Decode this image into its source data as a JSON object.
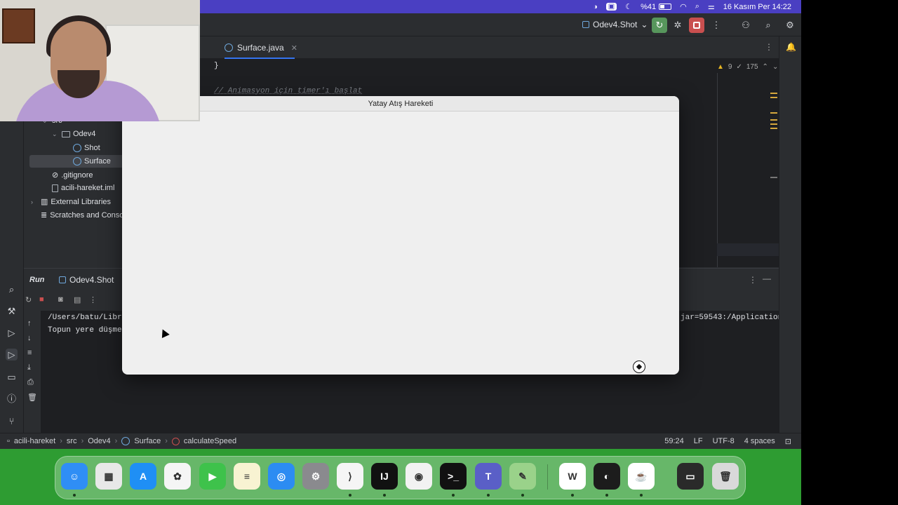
{
  "menubar": {
    "battery": "%41",
    "datetime": "16 Kasım Per  14:22"
  },
  "toolbar": {
    "run_config": "Odev4.Shot"
  },
  "editor": {
    "tab_label": "Surface.java",
    "code_brace": "}",
    "code_comment": "// Animasyon için timer'ı başlat",
    "warning_count": "9",
    "check_count": "175"
  },
  "project_tree": {
    "src": "src",
    "package": "Odev4",
    "file_shot": "Shot",
    "file_surface": "Surface",
    "gitignore": ".gitignore",
    "iml": "acili-hareket.iml",
    "external_libraries": "External Libraries",
    "scratches": "Scratches and Consoles"
  },
  "run_panel": {
    "title": "Run",
    "tab_label": "Odev4.Shot",
    "console_line1": "/Users/batu/Library",
    "console_line1_tail": "jar=59543:/Applications",
    "console_line2": "Topun yere düşme s"
  },
  "swing_window": {
    "title": "Yatay Atış Hareketi"
  },
  "statusbar": {
    "crumbs": [
      "acili-hareket",
      "src",
      "Odev4",
      "Surface",
      "calculateSpeed"
    ],
    "position": "59:24",
    "line_sep": "LF",
    "encoding": "UTF-8",
    "indent": "4 spaces"
  },
  "dock": {
    "apps": [
      {
        "name": "finder",
        "color": "#2f8ef5",
        "glyph": "☺"
      },
      {
        "name": "launchpad",
        "color": "#e8e8e8",
        "glyph": "▦"
      },
      {
        "name": "app-store",
        "color": "#1f8ff5",
        "glyph": "A"
      },
      {
        "name": "photos",
        "color": "#f5f5f5",
        "glyph": "✿"
      },
      {
        "name": "facetime",
        "color": "#3ec24b",
        "glyph": "▶"
      },
      {
        "name": "notes",
        "color": "#f8f3d2",
        "glyph": "≡"
      },
      {
        "name": "safari",
        "color": "#2c8cf2",
        "glyph": "◎"
      },
      {
        "name": "system-settings",
        "color": "#8a8a8e",
        "glyph": "⚙"
      },
      {
        "name": "vscode",
        "color": "#f5f5f5",
        "glyph": "⟩"
      },
      {
        "name": "intellij",
        "color": "#111111",
        "glyph": "IJ"
      },
      {
        "name": "chrome",
        "color": "#f2f2f2",
        "glyph": "◉"
      },
      {
        "name": "terminal",
        "color": "#111111",
        "glyph": ">_"
      },
      {
        "name": "teams",
        "color": "#5a5fc7",
        "glyph": "T"
      },
      {
        "name": "geogebra",
        "color": "#9ad28a",
        "glyph": "✎"
      },
      {
        "name": "word",
        "color": "#ffffff",
        "glyph": "W"
      },
      {
        "name": "obs",
        "color": "#1c1c1c",
        "glyph": "◐"
      },
      {
        "name": "java",
        "color": "#ffffff",
        "glyph": "☕"
      },
      {
        "name": "screen-capture",
        "color": "#2a2a2a",
        "glyph": "▭"
      },
      {
        "name": "trash",
        "color": "#d9d9d9",
        "glyph": "🗑"
      }
    ]
  }
}
